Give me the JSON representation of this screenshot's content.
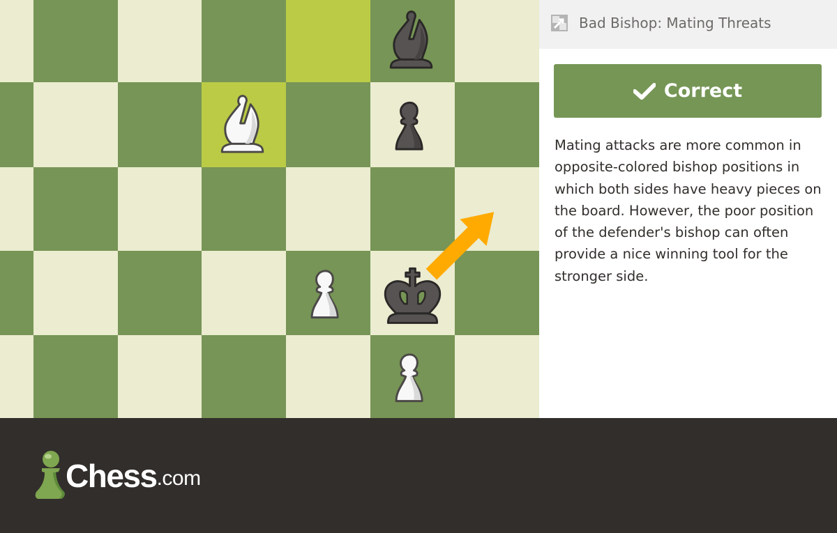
{
  "board": {
    "colors": {
      "light": "#ebecd0",
      "dark": "#779556",
      "highlight": "#bbcb46",
      "arrow": "#ffaa00"
    },
    "visible_files": [
      "a",
      "b",
      "c",
      "d",
      "e",
      "f",
      "g"
    ],
    "visible_ranks": [
      8,
      7,
      6,
      5,
      4
    ],
    "highlighted_squares": [
      "e8",
      "d7"
    ],
    "pieces": [
      {
        "square": "f8",
        "type": "bishop",
        "color": "black"
      },
      {
        "square": "d7",
        "type": "bishop",
        "color": "white"
      },
      {
        "square": "f7",
        "type": "pawn",
        "color": "black"
      },
      {
        "square": "e5",
        "type": "pawn",
        "color": "white"
      },
      {
        "square": "f5",
        "type": "king",
        "color": "black"
      },
      {
        "square": "f4",
        "type": "pawn",
        "color": "white"
      }
    ],
    "arrow": {
      "from": "f5",
      "to": "g6"
    }
  },
  "panel": {
    "header": {
      "icon": "expand-icon",
      "title": "Bad Bishop: Mating Threats"
    },
    "status_button": {
      "icon": "checkmark-icon",
      "label": "Correct"
    },
    "description": "Mating attacks are more common in opposite-colored bishop positions in which both sides have heavy pieces on the board. However, the poor position of the defender's bishop can often provide a nice winning tool for the stronger side."
  },
  "footer": {
    "logo": {
      "icon": "pawn-logo-icon",
      "text": "Chess",
      "suffix": ".com"
    }
  }
}
